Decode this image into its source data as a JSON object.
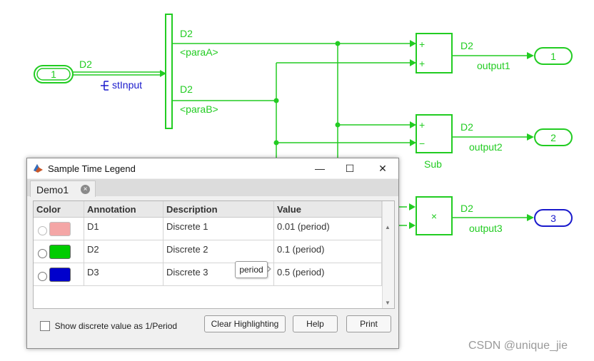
{
  "diagram": {
    "inport": "1",
    "inport_signal_label": "D2",
    "bus_label": "stInput",
    "bus_signal_a_rate": "D2",
    "bus_signal_a_name": "<paraA>",
    "bus_signal_b_rate": "D2",
    "bus_signal_b_name": "<paraB>",
    "sum1": {
      "sign_top": "+",
      "sign_bottom": "+",
      "out_rate": "D2",
      "out_name": "output1"
    },
    "sum2": {
      "sign_top": "+",
      "sign_bottom": "−",
      "out_rate": "D2",
      "out_name": "output2",
      "block_name": "Sub"
    },
    "product": {
      "symbol": "×",
      "out_rate": "D2",
      "out_name": "output3"
    },
    "outports": [
      "1",
      "2",
      "3"
    ],
    "colors": {
      "signal": "#22cc22",
      "discrete3": "#1a1acc"
    }
  },
  "dialog": {
    "title": "Sample Time Legend",
    "window_buttons": {
      "minimize": "—",
      "maximize": "☐",
      "close": "✕"
    },
    "tab_label": "Demo1",
    "tab_close": "×",
    "columns": [
      "Color",
      "Annotation",
      "Description",
      "Value"
    ],
    "rows": [
      {
        "color": "#f4a6a6",
        "annotation": "D1",
        "description": "Discrete 1",
        "value": "0.01 (period)",
        "faded": true
      },
      {
        "color": "#00cc00",
        "annotation": "D2",
        "description": "Discrete 2",
        "value": "0.1 (period)",
        "faded": false
      },
      {
        "color": "#0000cc",
        "annotation": "D3",
        "description": "Discrete 3",
        "value": "0.5 (period)",
        "faded": false
      }
    ],
    "tooltip": "period",
    "checkbox_label": "Show discrete value as 1/Period",
    "buttons": {
      "clear": "Clear Highlighting",
      "help": "Help",
      "print": "Print"
    }
  },
  "watermark": "CSDN @unique_jie"
}
